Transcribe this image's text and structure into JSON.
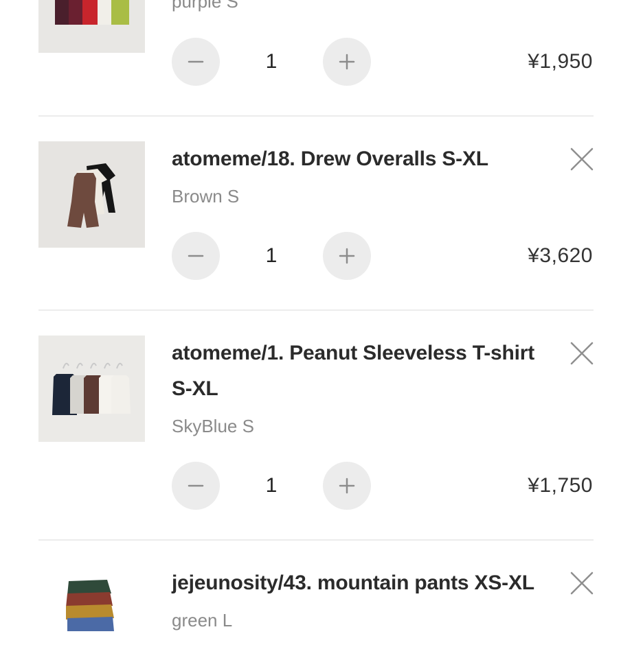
{
  "cart": {
    "items": [
      {
        "title": "",
        "variant": "purple S",
        "quantity": "1",
        "price": "¥1,950"
      },
      {
        "title": "atomeme/18. Drew Overalls S-XL",
        "variant": "Brown S",
        "quantity": "1",
        "price": "¥3,620"
      },
      {
        "title_line1": "atomeme/1. Peanut Sleeveless T-shirt",
        "title_line2": "S-XL",
        "variant": "SkyBlue S",
        "quantity": "1",
        "price": "¥1,750"
      },
      {
        "title": "jejeunosity/43. mountain pants XS-XL",
        "variant": "green L"
      }
    ],
    "icons": {
      "remove": "close-icon",
      "decrease": "minus-icon",
      "increase": "plus-icon"
    },
    "colors": {
      "button_bg": "#ececec",
      "divider": "#ececec",
      "title": "#2b2b2b",
      "variant": "#8a8a8a"
    }
  }
}
